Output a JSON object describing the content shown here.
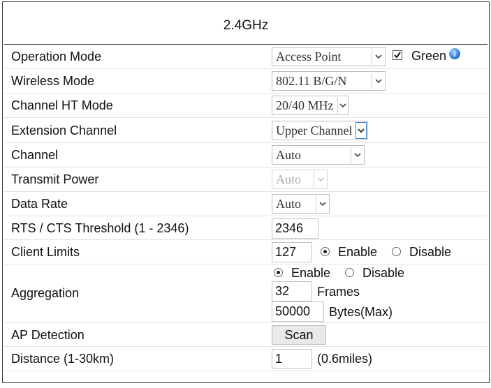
{
  "header": {
    "title": "2.4GHz"
  },
  "rows": {
    "operation_mode": {
      "label": "Operation Mode",
      "value": "Access Point",
      "green_label": "Green"
    },
    "wireless_mode": {
      "label": "Wireless Mode",
      "value": "802.11 B/G/N"
    },
    "channel_ht_mode": {
      "label": "Channel HT Mode",
      "value": "20/40 MHz"
    },
    "extension_channel": {
      "label": "Extension Channel",
      "value": "Upper Channel"
    },
    "channel": {
      "label": "Channel",
      "value": "Auto"
    },
    "transmit_power": {
      "label": "Transmit Power",
      "value": "Auto"
    },
    "data_rate": {
      "label": "Data Rate",
      "value": "Auto"
    },
    "rts_cts": {
      "label": "RTS / CTS Threshold (1 - 2346)",
      "value": "2346"
    },
    "client_limits": {
      "label": "Client Limits",
      "value": "127",
      "enable": "Enable",
      "disable": "Disable"
    },
    "aggregation": {
      "label": "Aggregation",
      "enable": "Enable",
      "disable": "Disable",
      "frames_value": "32",
      "frames_unit": "Frames",
      "bytes_value": "50000",
      "bytes_unit": "Bytes(Max)"
    },
    "ap_detection": {
      "label": "AP Detection",
      "button": "Scan"
    },
    "distance": {
      "label": "Distance (1-30km)",
      "value": "1",
      "miles": "(0.6miles)"
    }
  },
  "icons": {
    "info": "info-icon",
    "dropdown": "chevron-down-icon",
    "check": "checkmark-icon"
  },
  "colors": {
    "border": "#3a3a3a",
    "focus": "#3b7fd6",
    "info": "#1f6fd1"
  }
}
